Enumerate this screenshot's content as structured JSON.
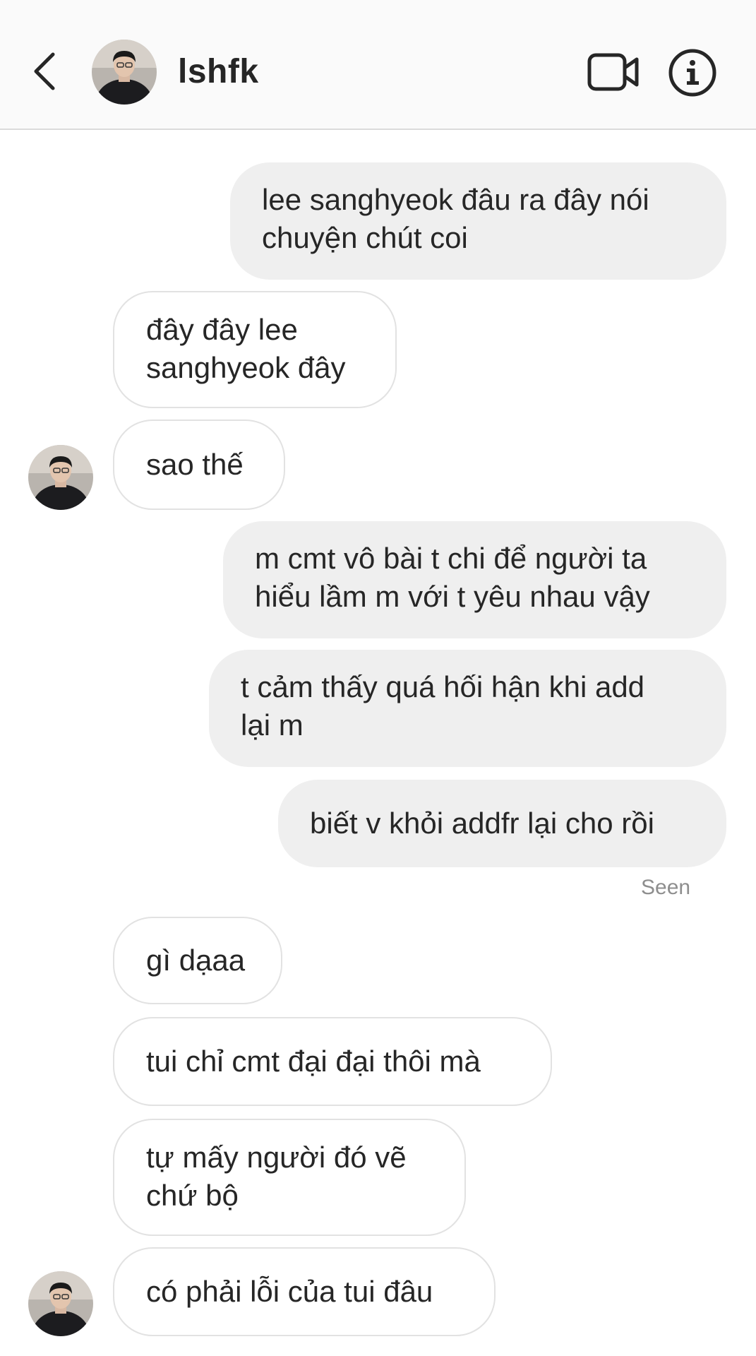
{
  "header": {
    "back_icon": "chevron-left-icon",
    "username": "lshfk",
    "avatar_icon": "profile-avatar",
    "video_icon": "video-camera-icon",
    "info_icon": "info-circle-icon"
  },
  "colors": {
    "outgoing_bubble": "#efefef",
    "incoming_border": "#e2e2e2",
    "header_bg": "#fafafa",
    "text": "#262626",
    "muted": "#8e8e8e"
  },
  "messages": [
    {
      "from": "me",
      "text": "lee sanghyeok đâu ra đây nói\nchuyện chút coi"
    },
    {
      "from": "them",
      "text": "đây đây lee\nsanghyeok đây"
    },
    {
      "from": "them",
      "text": "sao thế"
    },
    {
      "from": "me",
      "text": "m cmt vô bài t chi để người ta\nhiểu lầm m với t yêu nhau vậy"
    },
    {
      "from": "me",
      "text": "t cảm thấy quá hối hận khi add\nlại m"
    },
    {
      "from": "me",
      "text": "biết v khỏi addfr lại cho rồi"
    },
    {
      "from": "them",
      "text": "gì dạaa"
    },
    {
      "from": "them",
      "text": "tui chỉ cmt đại đại thôi mà"
    },
    {
      "from": "them",
      "text": "tự mấy người đó vẽ\nchứ bộ"
    },
    {
      "from": "them",
      "text": "có phải lỗi của tui đâu"
    }
  ],
  "status": {
    "seen_label": "Seen"
  }
}
